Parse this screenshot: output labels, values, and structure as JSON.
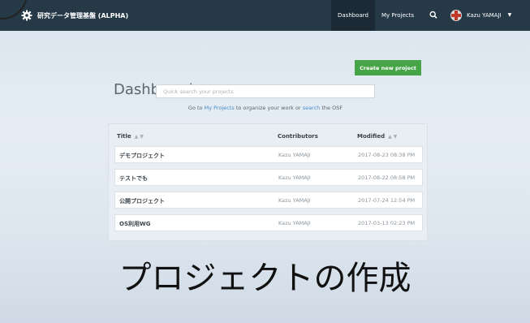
{
  "navbar": {
    "brand": "研究データ管理基盤 (ALPHA)",
    "brand_icon": "osf-cog-icon",
    "dashboard": "Dashboard",
    "my_projects": "My Projects",
    "search_icon": "search-icon",
    "user_name": "Kazu YAMAJI",
    "colors": {
      "bg": "#263947",
      "active": "#1b2a34"
    }
  },
  "main": {
    "title": "Dashboard",
    "create_button": "Create new project",
    "search_placeholder": "Quick search your projects",
    "hint": {
      "prefix": "Go to",
      "my_projects_link": "My Projects",
      "middle": "to organize your work or",
      "search_link": "search",
      "suffix": "the OSF"
    },
    "accent_color": "#47a447"
  },
  "table": {
    "columns": {
      "title": "Title",
      "contributors": "Contributors",
      "modified": "Modified"
    },
    "sort_arrows": "▲ ▼",
    "rows": [
      {
        "title": "デモプロジェクト",
        "contributors": "Kazu YAMAJI",
        "modified": "2017-08-23 08:38 PM"
      },
      {
        "title": "テストでも",
        "contributors": "Kazu YAMAJI",
        "modified": "2017-08-22 08:58 PM"
      },
      {
        "title": "公開プロジェクト",
        "contributors": "Kazu YAMAJI",
        "modified": "2017-07-24 12:54 PM"
      },
      {
        "title": "OS利用WG",
        "contributors": "Kazu YAMAJI",
        "modified": "2017-03-13 02:23 PM"
      }
    ]
  },
  "caption": "プロジェクトの作成"
}
